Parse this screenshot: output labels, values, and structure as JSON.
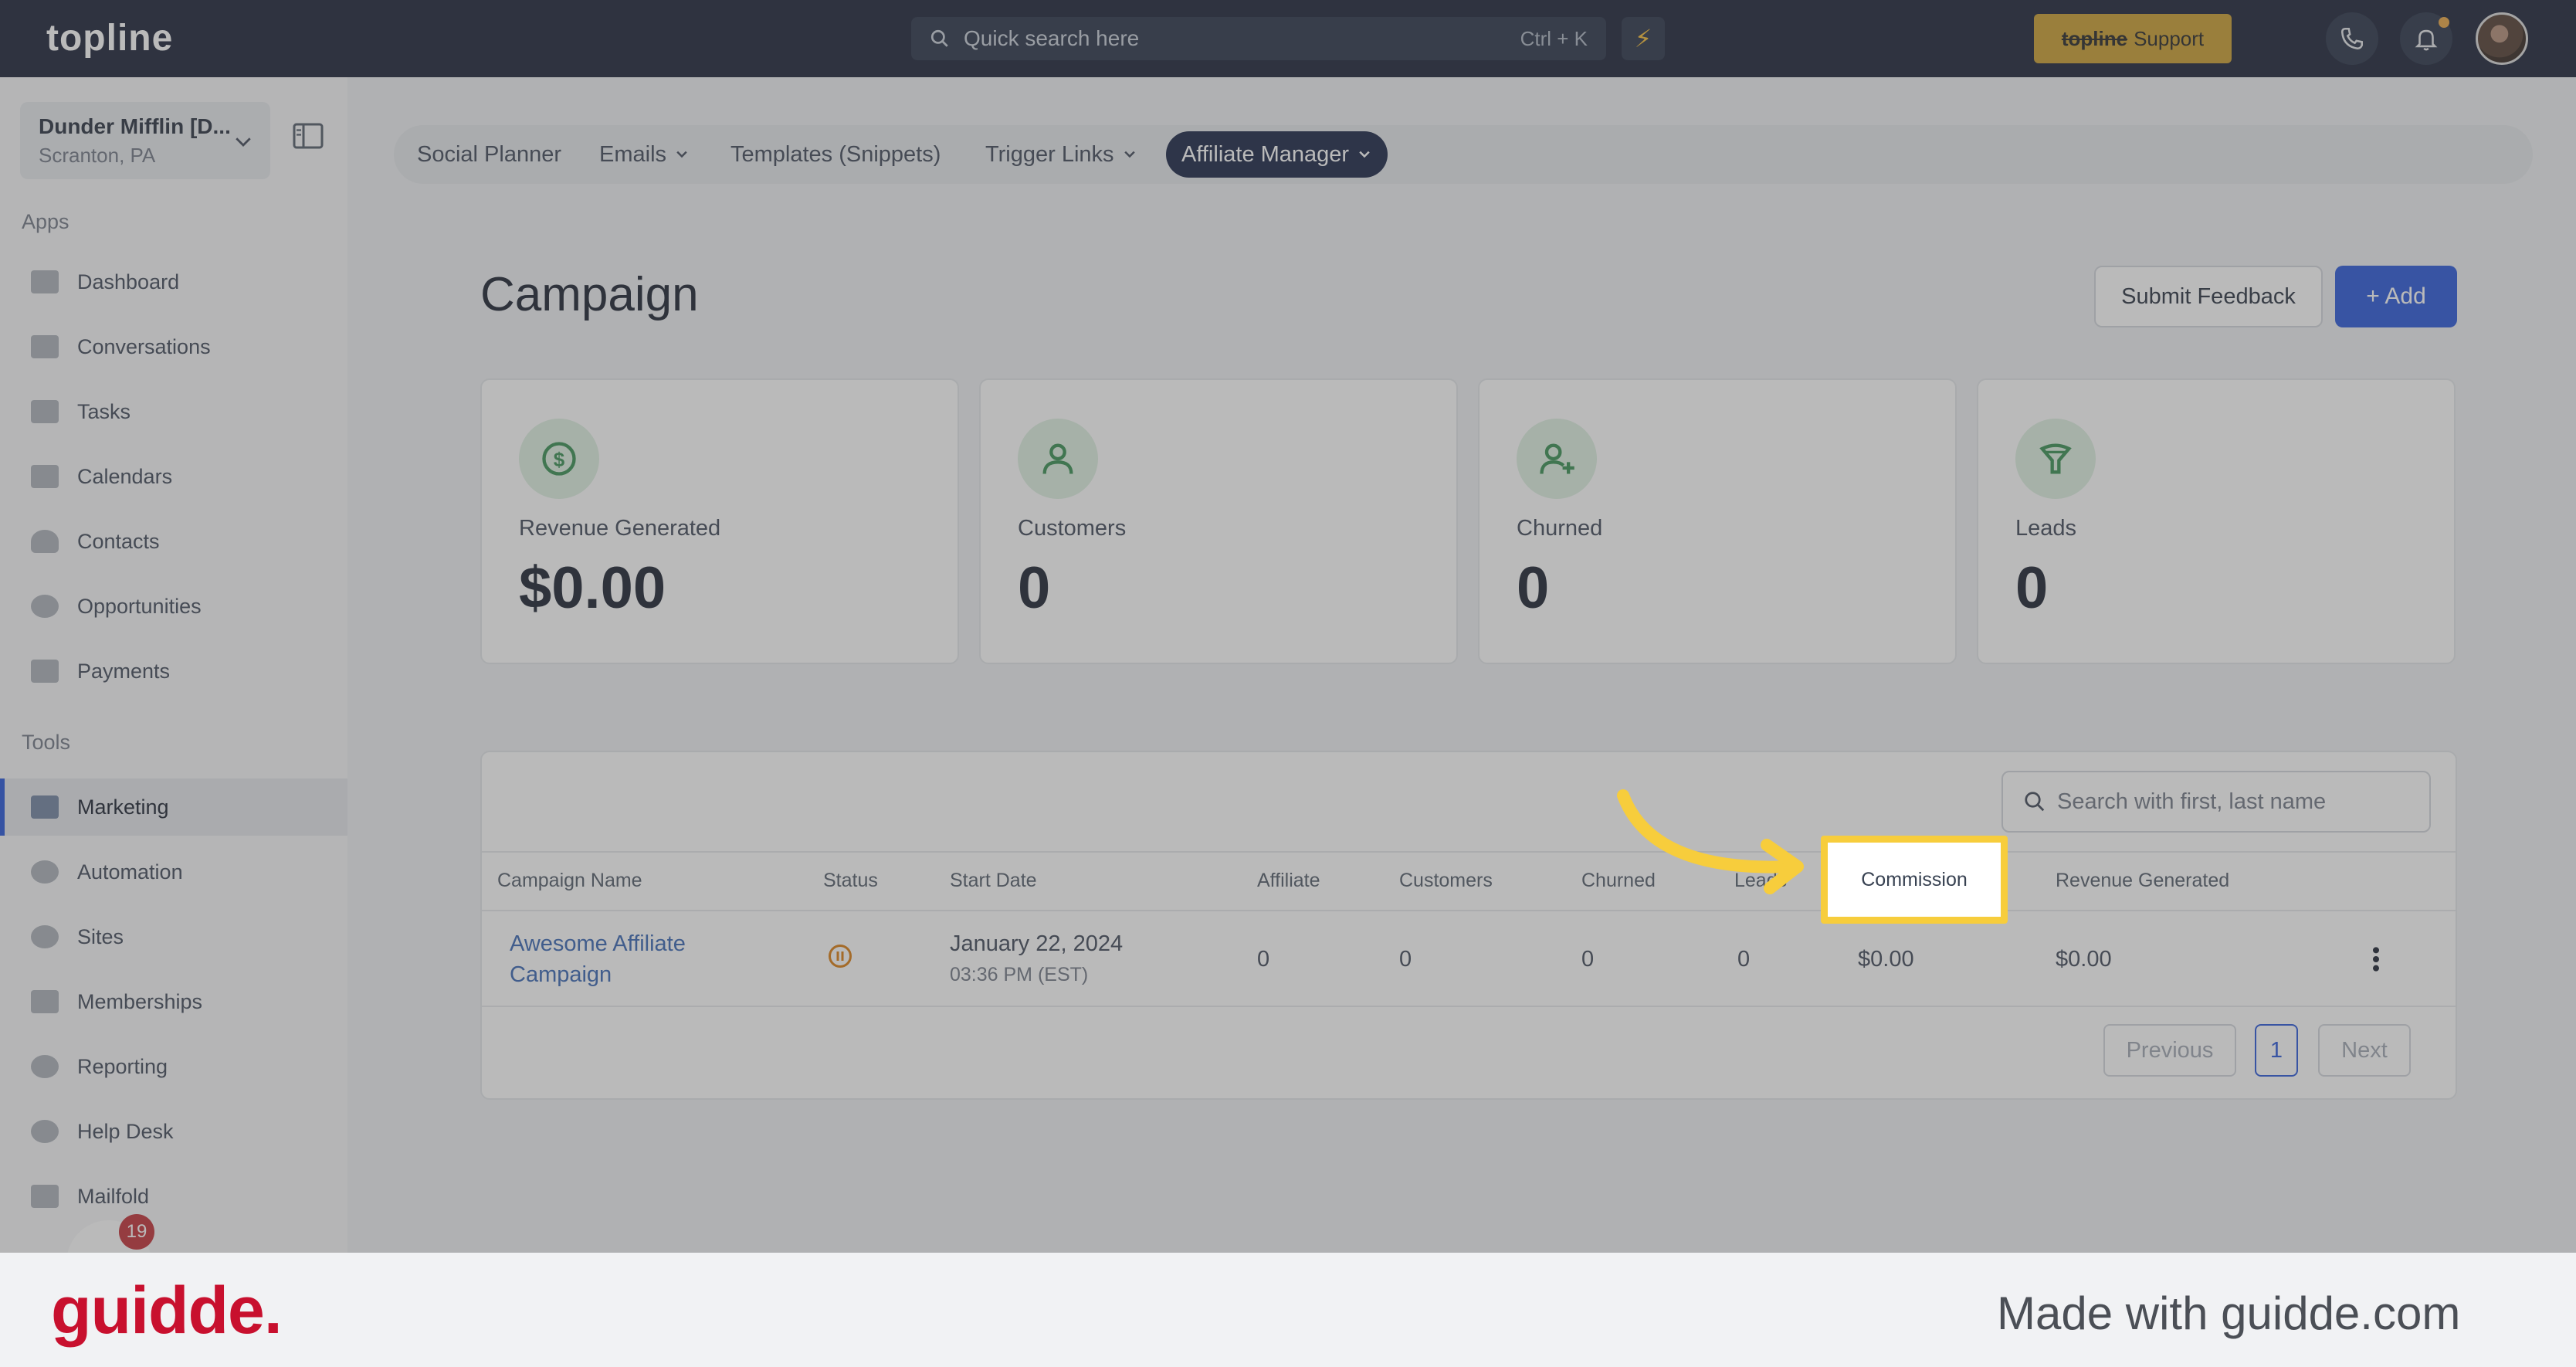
{
  "app": {
    "logo": "topline"
  },
  "topbar": {
    "search_placeholder": "Quick search here",
    "search_shortcut": "Ctrl + K",
    "support_brand": "topline",
    "support_label": "Support"
  },
  "location": {
    "name": "Dunder Mifflin [D...",
    "sub": "Scranton, PA"
  },
  "sidebar": {
    "apps_label": "Apps",
    "tools_label": "Tools",
    "apps": [
      {
        "label": "Dashboard",
        "icon": "dashboard-icon"
      },
      {
        "label": "Conversations",
        "icon": "chat-icon"
      },
      {
        "label": "Tasks",
        "icon": "clipboard-icon"
      },
      {
        "label": "Calendars",
        "icon": "calendar-icon"
      },
      {
        "label": "Contacts",
        "icon": "person-icon"
      },
      {
        "label": "Opportunities",
        "icon": "target-icon"
      },
      {
        "label": "Payments",
        "icon": "card-icon"
      }
    ],
    "tools": [
      {
        "label": "Marketing",
        "icon": "megaphone-icon",
        "active": true
      },
      {
        "label": "Automation",
        "icon": "gears-icon"
      },
      {
        "label": "Sites",
        "icon": "globe-icon"
      },
      {
        "label": "Memberships",
        "icon": "users-icon"
      },
      {
        "label": "Reporting",
        "icon": "pie-icon"
      },
      {
        "label": "Help Desk",
        "icon": "help-icon"
      },
      {
        "label": "Mailfold",
        "icon": "mail-icon"
      }
    ],
    "chat_badge_count": "19"
  },
  "subnav": [
    {
      "label": "Social Planner"
    },
    {
      "label": "Emails"
    },
    {
      "label": "Templates (Snippets)"
    },
    {
      "label": "Trigger Links"
    },
    {
      "label": "Affiliate Manager"
    }
  ],
  "page": {
    "title": "Campaign",
    "feedback_label": "Submit Feedback",
    "add_label": "+ Add"
  },
  "stats": [
    {
      "label": "Revenue Generated",
      "value": "$0.00",
      "icon": "dollar-icon"
    },
    {
      "label": "Customers",
      "value": "0",
      "icon": "user-icon"
    },
    {
      "label": "Churned",
      "value": "0",
      "icon": "user-plus-icon"
    },
    {
      "label": "Leads",
      "value": "0",
      "icon": "funnel-icon"
    }
  ],
  "table": {
    "search_placeholder": "Search with first, last name",
    "columns": [
      "Campaign Name",
      "Status",
      "Start Date",
      "Affiliate",
      "Customers",
      "Churned",
      "Leads",
      "Commission",
      "Revenue Generated"
    ],
    "rows": [
      {
        "name_line1": "Awesome Affiliate",
        "name_line2": "Campaign",
        "status": "paused",
        "date": "January 22, 2024",
        "time": "03:36 PM (EST)",
        "affiliate": "0",
        "customers": "0",
        "churned": "0",
        "leads": "0",
        "commission": "$0.00",
        "revenue": "$0.00"
      }
    ],
    "pagination": {
      "previous": "Previous",
      "current": "1",
      "next": "Next"
    }
  },
  "highlight": {
    "label": "Commission",
    "color": "#f7cd3c"
  },
  "footer": {
    "brand": "guidde.",
    "made_with": "Made with guidde.com"
  }
}
